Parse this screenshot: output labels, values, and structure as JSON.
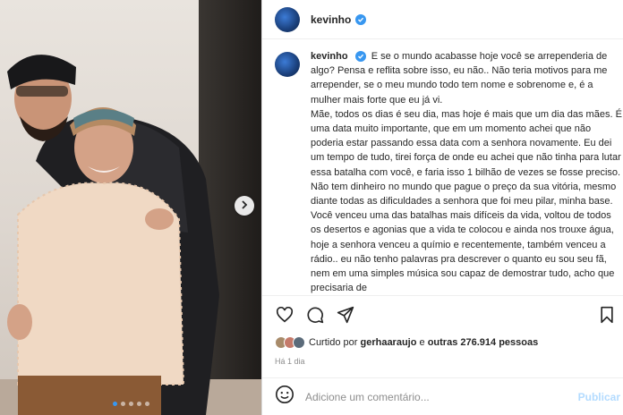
{
  "post": {
    "username": "kevinho",
    "caption_paragraphs": [
      "E se o mundo acabasse hoje você se arrependeria de algo? Pensa e reflita sobre isso, eu não.. Não teria motivos para me arrepender, se o meu mundo todo tem nome e sobrenome e, é a mulher mais forte que eu já vi.",
      "Mãe, todos os dias é seu dia, mas hoje é mais que um dia das mães. É uma data muito importante, que em um momento achei que não poderia estar passando essa data com a senhora novamente. Eu dei um tempo de tudo, tirei força de onde eu achei que não tinha para lutar essa batalha com você, e faria isso 1 bilhão de vezes se fosse preciso.",
      "Não tem dinheiro no mundo que pague o preço da sua vitória, mesmo diante todas as dificuldades a senhora que foi meu pilar, minha base. Você venceu uma das batalhas mais difíceis da vida, voltou de todos os desertos e agonias que a vida te colocou e ainda nos trouxe água, hoje a senhora venceu a químio e recentemente, também venceu a rádio.. eu não tenho palavras pra descrever o quanto eu sou seu fã, nem em uma simples música sou capaz de demostrar tudo, acho que precisaria de"
    ],
    "likes_prefix": "Curtido por",
    "likes_user": "gerhaaraujo",
    "likes_joiner": "e",
    "likes_count": "outras 276.914 pessoas",
    "time_ago": "Há 1 dia",
    "comment_placeholder": "Adicione um comentário...",
    "publish_label": "Publicar"
  },
  "carousel": {
    "dots_count": 5,
    "active_index": 0
  },
  "icons": {
    "like": "heart-icon",
    "comment": "comment-icon",
    "share": "share-icon",
    "save": "bookmark-icon",
    "emoji": "emoji-icon",
    "next": "chevron-right-icon",
    "verified": "verified-badge-icon"
  },
  "colors": {
    "verified": "#3897f0",
    "publish": "#b3dbff",
    "muted": "#8e8e8e"
  }
}
